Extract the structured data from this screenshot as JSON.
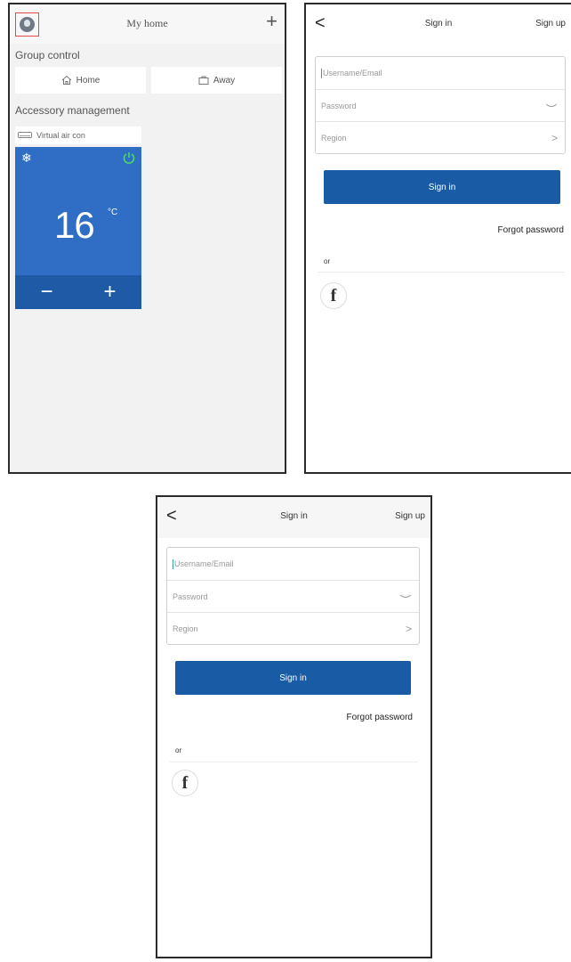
{
  "home": {
    "title": "My home",
    "add_label": "+",
    "group_control_label": "Group control",
    "groups": [
      {
        "label": "Home",
        "icon": "house-icon"
      },
      {
        "label": "Away",
        "icon": "suitcase-icon"
      }
    ],
    "accessory_label": "Accessory management",
    "device": {
      "name": "Virtual air con",
      "temperature": "16",
      "unit": "°C",
      "minus_label": "−",
      "plus_label": "+",
      "mode_icon": "snowflake-icon",
      "power_icon": "power-icon"
    },
    "colors": {
      "card": "#2f6ec4",
      "card_bottom": "#1f5aa6",
      "power": "#4cd964",
      "avatar_highlight": "#e34b4b"
    }
  },
  "signin_1": {
    "back_label": "<",
    "title": "Sign in",
    "signup_label": "Sign up",
    "username_placeholder": "Username/Email",
    "password_placeholder": "Password",
    "region_placeholder": "Region",
    "region_chevron": ">",
    "button_label": "Sign in",
    "forgot_label": "Forgot password",
    "or_label": "or",
    "facebook_label": "f"
  },
  "signin_2": {
    "back_label": "<",
    "title": "Sign in",
    "signup_label": "Sign up",
    "username_placeholder": "Username/Email",
    "password_placeholder": "Password",
    "region_placeholder": "Region",
    "region_chevron": ">",
    "button_label": "Sign in",
    "forgot_label": "Forgot password",
    "or_label": "or",
    "facebook_label": "f"
  },
  "accent_color": "#1a5ba6"
}
